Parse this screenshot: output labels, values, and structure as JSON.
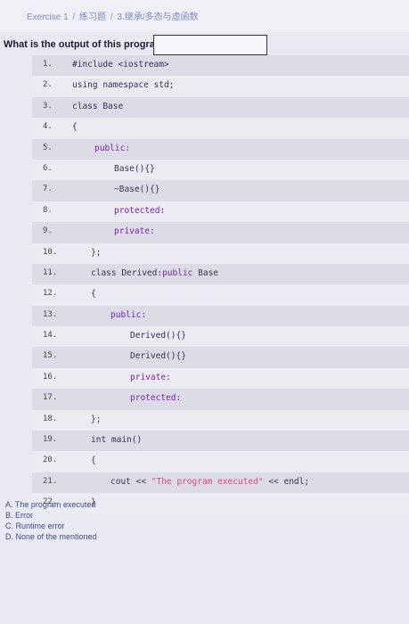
{
  "header": {
    "breadcrumb": [
      "Exercise 1",
      "/",
      "练习题",
      "/",
      "3.继承/多态与虚函数"
    ]
  },
  "question": {
    "text": "What is the output of this program?",
    "answer_value": ""
  },
  "code_lines": [
    {
      "num": "1.",
      "indent": 45,
      "parts": [
        {
          "t": "#include <iostream>",
          "c": ""
        }
      ]
    },
    {
      "num": "2.",
      "indent": 45,
      "parts": [
        {
          "t": "using namespace std;",
          "c": ""
        }
      ]
    },
    {
      "num": "3.",
      "indent": 45,
      "parts": [
        {
          "t": "class Base",
          "c": ""
        }
      ]
    },
    {
      "num": "4.",
      "indent": 45,
      "parts": [
        {
          "t": "{",
          "c": ""
        }
      ]
    },
    {
      "num": "5.",
      "indent": 70,
      "parts": [
        {
          "t": "public:",
          "c": "kw"
        }
      ]
    },
    {
      "num": "6.",
      "indent": 92,
      "parts": [
        {
          "t": "Base(){}",
          "c": ""
        }
      ]
    },
    {
      "num": "7.",
      "indent": 92,
      "parts": [
        {
          "t": "~Base(){}",
          "c": ""
        }
      ]
    },
    {
      "num": "8.",
      "indent": 92,
      "parts": [
        {
          "t": "protected:",
          "c": "kw"
        }
      ]
    },
    {
      "num": "9.",
      "indent": 92,
      "parts": [
        {
          "t": "private:",
          "c": "kw"
        }
      ]
    },
    {
      "num": "10.",
      "indent": 66,
      "parts": [
        {
          "t": "};",
          "c": ""
        }
      ]
    },
    {
      "num": "11.",
      "indent": 66,
      "parts": [
        {
          "t": "class Derived:",
          "c": ""
        },
        {
          "t": "public",
          "c": "kw"
        },
        {
          "t": " Base",
          "c": ""
        }
      ]
    },
    {
      "num": "12.",
      "indent": 66,
      "parts": [
        {
          "t": "{",
          "c": ""
        }
      ]
    },
    {
      "num": "13.",
      "indent": 88,
      "parts": [
        {
          "t": "public:",
          "c": "kw"
        }
      ]
    },
    {
      "num": "14.",
      "indent": 110,
      "parts": [
        {
          "t": "Derived(){}",
          "c": ""
        }
      ]
    },
    {
      "num": "15.",
      "indent": 110,
      "parts": [
        {
          "t": "Derived(){}",
          "c": ""
        }
      ]
    },
    {
      "num": "16.",
      "indent": 110,
      "parts": [
        {
          "t": "private:",
          "c": "kw"
        }
      ]
    },
    {
      "num": "17.",
      "indent": 110,
      "parts": [
        {
          "t": "protected:",
          "c": "kw"
        }
      ]
    },
    {
      "num": "18.",
      "indent": 66,
      "parts": [
        {
          "t": "};",
          "c": ""
        }
      ]
    },
    {
      "num": "19.",
      "indent": 66,
      "parts": [
        {
          "t": "int main()",
          "c": ""
        }
      ]
    },
    {
      "num": "20.",
      "indent": 66,
      "parts": [
        {
          "t": "{",
          "c": ""
        }
      ]
    },
    {
      "num": "21.",
      "indent": 88,
      "parts": [
        {
          "t": "cout << ",
          "c": ""
        },
        {
          "t": "\"The program executed\"",
          "c": "str"
        },
        {
          "t": " << endl;",
          "c": ""
        }
      ]
    },
    {
      "num": "22.",
      "indent": 66,
      "parts": [
        {
          "t": "}",
          "c": ""
        }
      ]
    }
  ],
  "options": [
    "A. The program executed",
    "B. Error",
    "C. Runtime error",
    "D. None of the mentioned"
  ]
}
